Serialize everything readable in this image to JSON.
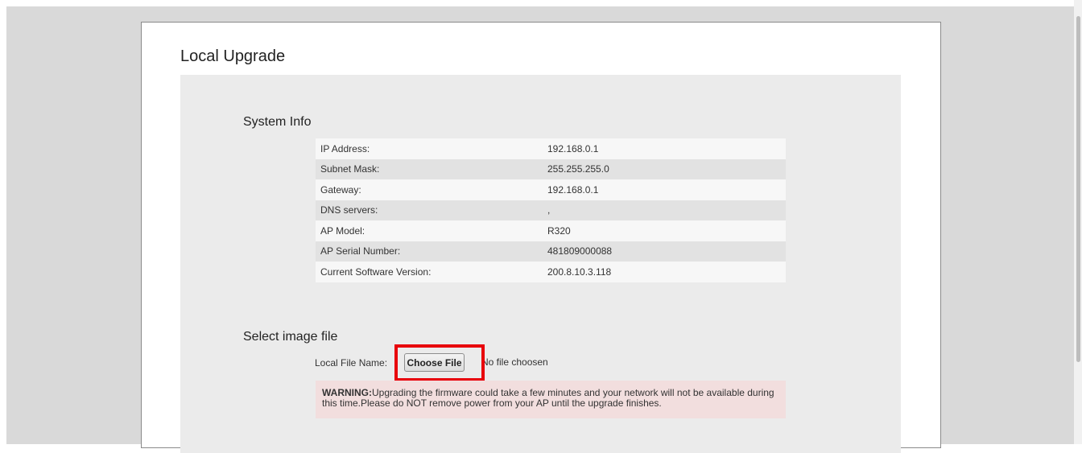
{
  "page": {
    "title": "Local Upgrade"
  },
  "system_info": {
    "title": "System Info",
    "rows": [
      {
        "label": "IP Address:",
        "value": "192.168.0.1"
      },
      {
        "label": "Subnet Mask:",
        "value": "255.255.255.0"
      },
      {
        "label": "Gateway:",
        "value": "192.168.0.1"
      },
      {
        "label": "DNS servers:",
        "value": ","
      },
      {
        "label": "AP Model:",
        "value": "R320"
      },
      {
        "label": "AP Serial Number:",
        "value": "481809000088"
      },
      {
        "label": "Current Software Version:",
        "value": "200.8.10.3.118"
      }
    ]
  },
  "image_file": {
    "title": "Select image file",
    "local_file_label": "Local File Name:",
    "choose_button": "Choose File",
    "file_status": "No file choosen"
  },
  "warning": {
    "prefix": "WARNING:",
    "text": "Upgrading the firmware could take a few minutes and your network will not be available during this time.Please do NOT remove power from your AP until the upgrade finishes."
  },
  "colors": {
    "highlight": "#e8000b",
    "warning_bg": "#f2dede",
    "panel_bg": "#ebebeb"
  }
}
